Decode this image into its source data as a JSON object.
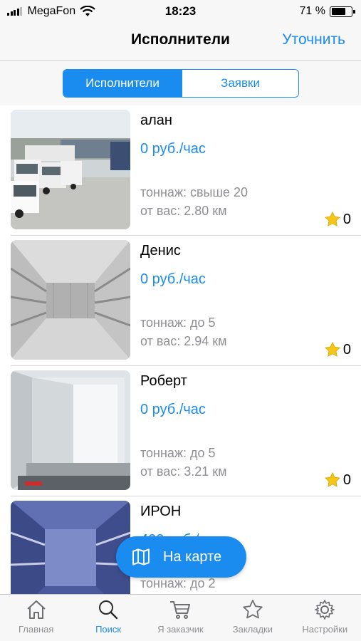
{
  "status_bar": {
    "carrier": "MegaFon",
    "time": "18:23",
    "battery_percent": "71 %",
    "battery_level": 0.71
  },
  "nav": {
    "title": "Исполнители",
    "action": "Уточнить"
  },
  "segments": [
    {
      "label": "Исполнители",
      "active": true
    },
    {
      "label": "Заявки",
      "active": false
    }
  ],
  "performers": [
    {
      "name": "алан",
      "price": "0 руб./час",
      "tonnage": "тоннаж: свыше 20",
      "distance": "от вас: 2.80 км",
      "rating": "0",
      "image": "truck-parking-photo"
    },
    {
      "name": "Денис",
      "price": "0 руб./час",
      "tonnage": "тоннаж: до 5",
      "distance": "от вас: 2.94 км",
      "rating": "0",
      "image": "cargo-box-interior-photo"
    },
    {
      "name": "Роберт",
      "price": "0 руб./час",
      "tonnage": "тоннаж: до 5",
      "distance": "от вас: 3.21 км",
      "rating": "0",
      "image": "open-cargo-box-photo"
    },
    {
      "name": "ИРОН",
      "price": "400 руб./час",
      "tonnage": "тоннаж: до 2",
      "distance": "",
      "rating": "",
      "image": "blue-cargo-interior-photo"
    }
  ],
  "map_button": {
    "label": "На карте",
    "icon": "map-icon"
  },
  "tabs": [
    {
      "label": "Главная",
      "icon": "home-icon",
      "active": false
    },
    {
      "label": "Поиск",
      "icon": "search-icon",
      "active": true
    },
    {
      "label": "Я заказчик",
      "icon": "cart-icon",
      "active": false
    },
    {
      "label": "Закладки",
      "icon": "star-icon",
      "active": false
    },
    {
      "label": "Настройки",
      "icon": "gear-icon",
      "active": false
    }
  ],
  "colors": {
    "accent": "#1a8cf0",
    "secondary_text": "#8e8e93",
    "star": "#f5c518"
  }
}
